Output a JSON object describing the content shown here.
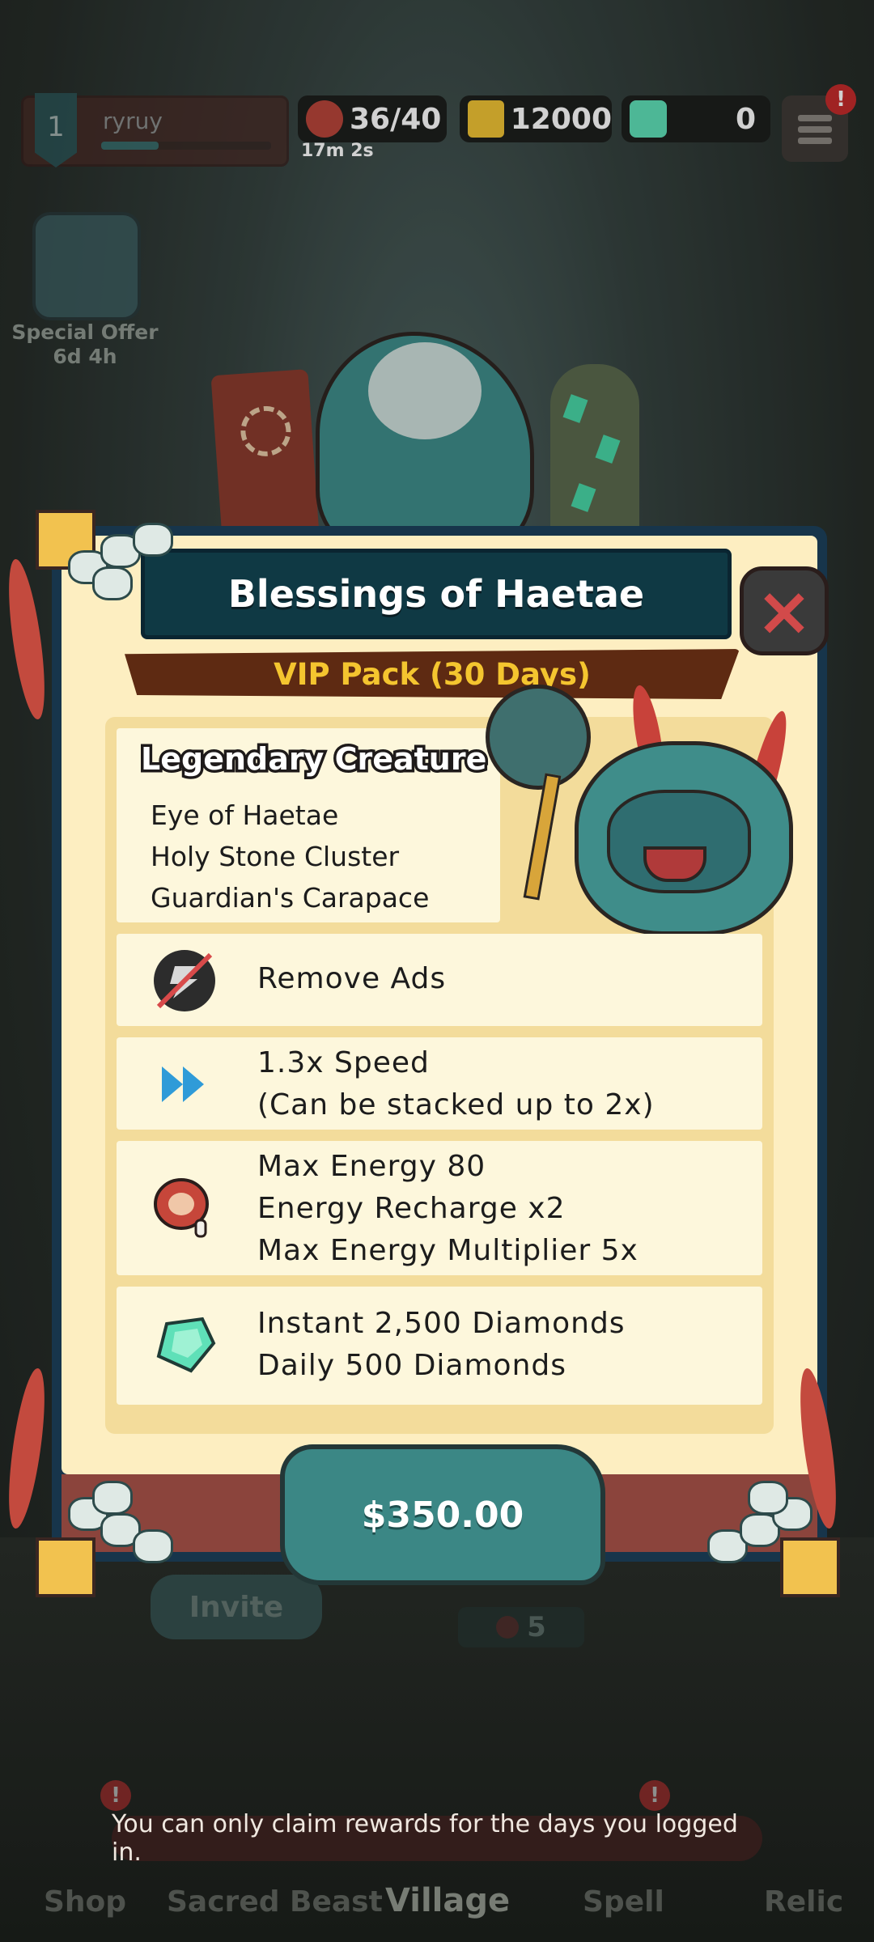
{
  "topbar": {
    "level": "1",
    "username": "ryruy",
    "energy": "36/40",
    "energy_timer": "17m 2s",
    "gold": "12000",
    "diamonds": "0",
    "menu_badge": "!"
  },
  "special_offer": {
    "label": "Special Offer",
    "timer": "6d 4h"
  },
  "modal": {
    "title": "Blessings of Haetae",
    "subtitle": "VIP Pack (30 Days)",
    "close_icon": "close-icon",
    "legend": {
      "heading": "Legendary Creature",
      "items": [
        "Eye of Haetae",
        "Holy Stone Cluster",
        "Guardian's Carapace"
      ]
    },
    "benefits": [
      {
        "icon": "no-ads-icon",
        "line1": "Remove Ads",
        "line2": "",
        "line3": ""
      },
      {
        "icon": "fast-forward-icon",
        "line1": "1.3x Speed",
        "line2": "(Can be stacked up to 2x)",
        "line3": ""
      },
      {
        "icon": "meat-energy-icon",
        "line1": "Max Energy 80",
        "line2": "Energy Recharge x2",
        "line3": "Max Energy Multiplier 5x"
      },
      {
        "icon": "diamond-icon",
        "line1": "Instant 2,500 Diamonds",
        "line2": "Daily 500 Diamonds",
        "line3": ""
      }
    ],
    "price": "$350.00"
  },
  "background": {
    "invite_label": "Invite",
    "cost_value": "5"
  },
  "toast": "You can only claim rewards for the days you logged in.",
  "nav": {
    "items": [
      "Shop",
      "Sacred Beast",
      "Village",
      "Spell",
      "Relic"
    ],
    "active": "Village"
  },
  "colors": {
    "accent_teal": "#3b8785",
    "title_banner": "#0f3944",
    "vip_text": "#f4c52f",
    "panel": "#fdeec1",
    "close_red": "#d24a4a"
  }
}
